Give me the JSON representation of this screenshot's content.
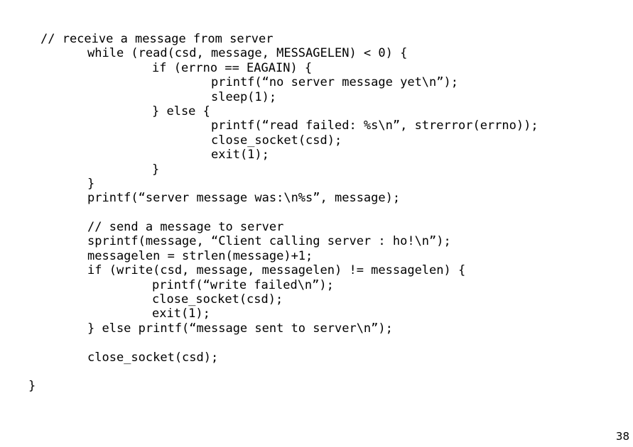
{
  "slide": {
    "page_number": "38",
    "background_color": "#ffffff",
    "text_color": "#000000",
    "code_lines": [
      {
        "indent": 1,
        "text": "// receive a message from server"
      },
      {
        "indent": 2,
        "text": "while (read(csd, message, MESSAGELEN) < 0) {"
      },
      {
        "indent": 3,
        "text": "if (errno == EAGAIN) {"
      },
      {
        "indent": 4,
        "text": "printf(“no server message yet\\n”);"
      },
      {
        "indent": 4,
        "text": "sleep(1);"
      },
      {
        "indent": 3,
        "text": "} else {"
      },
      {
        "indent": 4,
        "text": "printf(“read failed: %s\\n”, strerror(errno));"
      },
      {
        "indent": 4,
        "text": "close_socket(csd);"
      },
      {
        "indent": 4,
        "text": "exit(1);"
      },
      {
        "indent": 3,
        "text": "}"
      },
      {
        "indent": 2,
        "text": "}"
      },
      {
        "indent": 2,
        "text": "printf(“server message was:\\n%s”, message);"
      },
      {
        "indent": 2,
        "text": ""
      },
      {
        "indent": 2,
        "text": "// send a message to server"
      },
      {
        "indent": 2,
        "text": "sprintf(message, “Client calling server : ho!\\n”);"
      },
      {
        "indent": 2,
        "text": "messagelen = strlen(message)+1;"
      },
      {
        "indent": 2,
        "text": "if (write(csd, message, messagelen) != messagelen) {"
      },
      {
        "indent": 3,
        "text": "printf(“write failed\\n”);"
      },
      {
        "indent": 3,
        "text": "close_socket(csd);"
      },
      {
        "indent": 3,
        "text": "exit(1);"
      },
      {
        "indent": 2,
        "text": "} else printf(“message sent to server\\n”);"
      },
      {
        "indent": 2,
        "text": ""
      },
      {
        "indent": 2,
        "text": "close_socket(csd);"
      },
      {
        "indent": 2,
        "text": ""
      },
      {
        "indent": 0,
        "text": "}"
      }
    ]
  }
}
